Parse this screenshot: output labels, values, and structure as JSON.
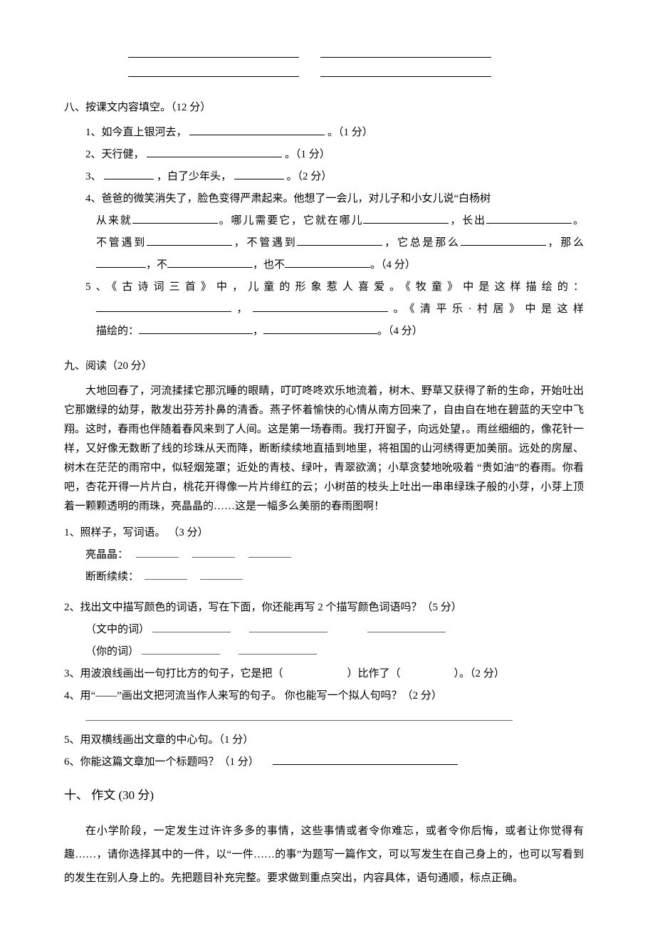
{
  "topBlanks": {
    "rows": 2
  },
  "sec8": {
    "title": "八、按课文内容填空。（12 分）",
    "q1": "1、如今直上银河去，",
    "q1_tail": "。（1 分）",
    "q2": "2、天行健，",
    "q2_tail": "。（1 分）",
    "q3_a": "3、",
    "q3_b": "，白了少年头，",
    "q3_tail": "。（2 分）",
    "q4_a": "4、爸爸的微笑消失了，脸色变得严肃起来。他想了一会儿，对儿子和小女儿说“白杨树",
    "q4_b": "从来就",
    "q4_c": "。哪儿需要它，它就在哪儿",
    "q4_d": "，长出",
    "q4_e": "。",
    "q4_f": "不管遇到",
    "q4_g": "，不管遇到",
    "q4_h": "，它总是那么",
    "q4_i": "，那么",
    "q4_j": "，不",
    "q4_k": "，也不",
    "q4_l": "。（4 分）",
    "q5_a": "5、《古诗词三首》中，儿童的形象惹人喜爱。《牧童》中是这样描绘的：",
    "q5_b": "，",
    "q5_c": "。《清平乐·村居》中是这样",
    "q5_d": "描绘的：",
    "q5_e": "，",
    "q5_tail": "。（4 分）"
  },
  "sec9": {
    "title": "九、阅读（20 分）",
    "passage": "大地回春了，河流揉揉它那沉睡的眼睛，叮叮咚咚欢乐地流着，树木、野草又获得了新的生命，开始吐出它那嫩绿的幼芽，散发出芬芳扑鼻的清香。燕子怀着愉快的心情从南方回来了，自由自在地在碧蓝的天空中飞翔。这时，春雨也伴随着春风来到了人间。这是第一场春雨。我打开窗子，向远处望，。雨丝细细的，像花针一样，又好像无数断了线的珍珠从天而降，断断续续地直插到地里，将祖国的山河绣得更加美丽。远处的房屋、树木在茫茫的雨帘中，似轻烟笼罩；近处的青枝、绿叶，青翠欲滴；小草贪婪地吮吸着 “贵如油”的春雨。你看吧，杏花开得一片片白，桃花开得像一片片绯红的云；小树苗的枝头上吐出一串串绿珠子般的小芽，小芽上顶着一颗颗透明的雨珠，亮晶晶的……这是一幅多么美丽的春雨图啊！",
    "q1": "1、照样子，写词语。 （3 分）",
    "q1a": "亮晶晶：",
    "q1b": "断断续续：",
    "q2": "2、找出文中描写颜色的词语，写在下面，你还能再写 2 个描写颜色词语吗？（5 分）",
    "q2a": "（文中的词）",
    "q2b": "（你的词）",
    "q3": "3、用波浪线画出一句打比方的句子，它是把（　　　　　　）比作了（　　　　　）。（2 分）",
    "q4": "4、用“——”画出文把河流当作人来写的句子。 你也能写一个拟人句吗？（2 分）",
    "q5": "5、用双横线画出文章的中心句。（1 分）",
    "q6": "6、你能这篇文章加一个标题吗？（1 分）"
  },
  "sec10": {
    "title": "十、 作文 (30 分)",
    "body": "在小学阶段，一定发生过许许多多的事情，这些事情或者令你难忘，或者令你后悔，或者让你觉得有趣……，请你选择其中的一件，以“一件……的事”为题写一篇作文，可以写发生在自己身上的，也可以写看到的发生在别人身上的。先把题目补充完整。要求做到重点突出，内容具体，语句通顺，标点正确。"
  }
}
